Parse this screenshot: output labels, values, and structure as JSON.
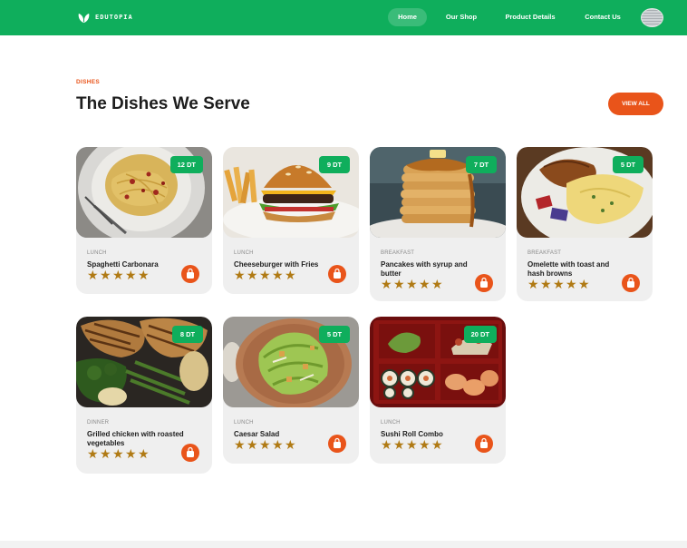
{
  "brand": {
    "name": "EDUTOPIA"
  },
  "nav": {
    "home": "Home",
    "shop": "Our Shop",
    "product_details": "Product Details",
    "contact": "Contact Us"
  },
  "section": {
    "label": "DISHES",
    "title": "The Dishes We Serve",
    "view_all": "VIEW ALL"
  },
  "colors": {
    "brand_green": "#0fae5c",
    "accent_orange": "#e9541a",
    "star_gold": "#b07a14"
  },
  "dishes": [
    {
      "category": "LUNCH",
      "name": "Spaghetti Carbonara",
      "price": "12 DT",
      "rating": 5,
      "image": "spaghetti-photo"
    },
    {
      "category": "LUNCH",
      "name": "Cheeseburger with Fries",
      "price": "9 DT",
      "rating": 5,
      "image": "burger-photo"
    },
    {
      "category": "BREAKFAST",
      "name": "Pancakes with syrup and butter",
      "price": "7 DT",
      "rating": 5,
      "image": "pancakes-photo"
    },
    {
      "category": "BREAKFAST",
      "name": "Omelette with toast and hash browns",
      "price": "5 DT",
      "rating": 5,
      "image": "omelette-photo"
    },
    {
      "category": "DINNER",
      "name": "Grilled chicken with roasted vegetables",
      "price": "8 DT",
      "rating": 5,
      "image": "grilled-chicken-photo"
    },
    {
      "category": "LUNCH",
      "name": "Caesar Salad",
      "price": "5 DT",
      "rating": 5,
      "image": "caesar-salad-photo"
    },
    {
      "category": "LUNCH",
      "name": "Sushi Roll Combo",
      "price": "20 DT",
      "rating": 5,
      "image": "sushi-photo"
    }
  ]
}
